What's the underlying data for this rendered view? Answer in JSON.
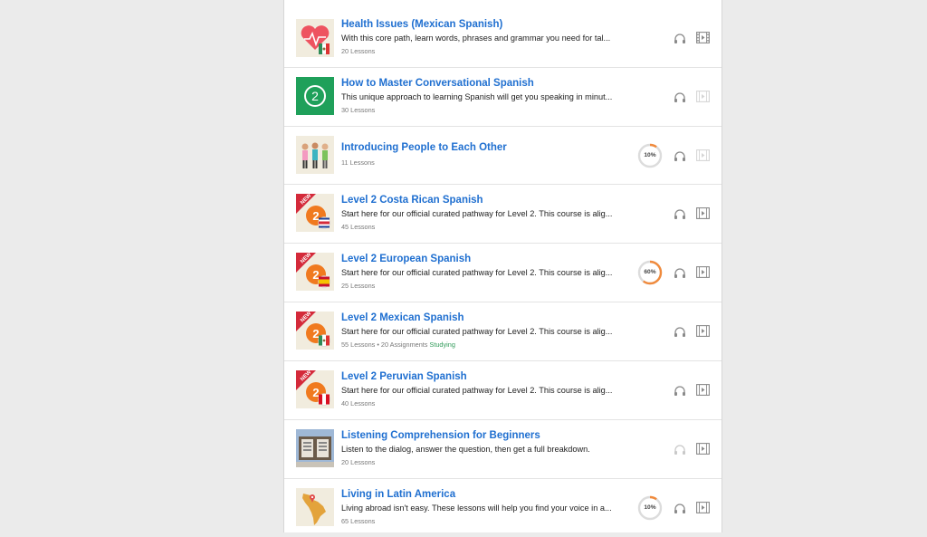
{
  "courses": [
    {
      "title": "Health Issues (Mexican Spanish)",
      "description": "With this core path, learn words, phrases and grammar you need for tal...",
      "lessons": "20 Lessons",
      "thumb": "heart-mexico-flag-icon",
      "audio_active": false,
      "video_active": true
    },
    {
      "title": "How to Master Conversational Spanish",
      "description": "This unique approach to learning Spanish will get you speaking in minut...",
      "lessons": "30 Lessons",
      "thumb": "green-number-2-icon",
      "audio_active": false,
      "video_active": false
    },
    {
      "title": "Introducing People to Each Other",
      "description": "",
      "lessons": "11 Lessons",
      "thumb": "people-illustration",
      "progress": 10,
      "progress_label": "10%",
      "audio_active": false,
      "video_active": false
    },
    {
      "title": "Level 2 Costa Rican Spanish",
      "description": "Start here for our official curated pathway for Level 2. This course is alig...",
      "lessons": "45 Lessons",
      "thumb": "new-level-2-costa-rica-icon",
      "audio_active": false,
      "video_active": true
    },
    {
      "title": "Level 2 European Spanish",
      "description": "Start here for our official curated pathway for Level 2. This course is alig...",
      "lessons": "25 Lessons",
      "thumb": "new-level-2-spain-icon",
      "progress": 60,
      "progress_label": "60%",
      "audio_active": false,
      "video_active": true
    },
    {
      "title": "Level 2 Mexican Spanish",
      "description": "Start here for our official curated pathway for Level 2. This course is alig...",
      "lessons": "55 Lessons • 20 Assignments",
      "status": "Studying",
      "thumb": "new-level-2-mexico-icon",
      "audio_active": false,
      "video_active": true
    },
    {
      "title": "Level 2 Peruvian Spanish",
      "description": "Start here for our official curated pathway for Level 2. This course is alig...",
      "lessons": "40 Lessons",
      "thumb": "new-level-2-peru-icon",
      "audio_active": false,
      "video_active": true
    },
    {
      "title": "Listening Comprehension for Beginners",
      "description": "Listen to the dialog, answer the question, then get a full breakdown.",
      "lessons": "20 Lessons",
      "thumb": "listening-board-icon",
      "audio_active": false,
      "video_active": true
    },
    {
      "title": "Living in Latin America",
      "description": "Living abroad isn't easy. These lessons will help you find your voice in a...",
      "lessons": "65 Lessons",
      "thumb": "latin-america-map-icon",
      "progress": 10,
      "progress_label": "10%",
      "audio_active": false,
      "video_active": true
    }
  ],
  "badge_text": "NEW",
  "level_number": "2",
  "colors": {
    "title": "#1f6fd0",
    "status": "#2f9a58",
    "progress": "#f08a3c",
    "icon": "#8a8a8a"
  }
}
